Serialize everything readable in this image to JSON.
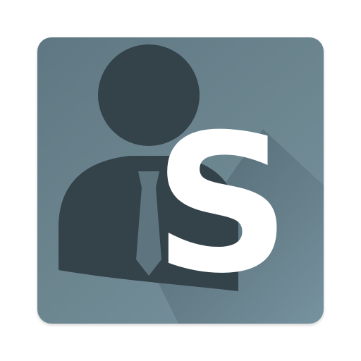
{
  "icon": {
    "name": "businessman-s-logo-icon",
    "letter": "S",
    "colors": {
      "tile_dark": "#5f7782",
      "tile_light": "#7793a0",
      "person": "#34424a",
      "tie": "#5e7580",
      "letter": "#ffffff",
      "long_shadow": "#4f6571"
    }
  }
}
